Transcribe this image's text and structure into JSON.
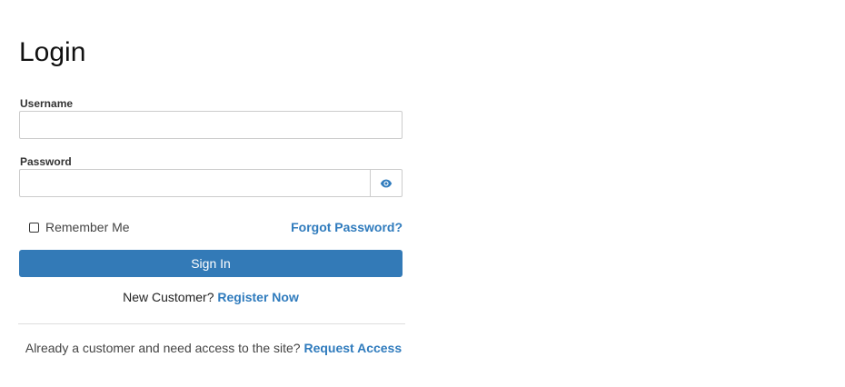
{
  "page": {
    "title": "Login"
  },
  "form": {
    "username_label": "Username",
    "username_value": "",
    "password_label": "Password",
    "password_value": "",
    "reveal_icon": "eye-icon",
    "remember_label": "Remember Me",
    "remember_checked": false,
    "forgot_link": "Forgot Password?",
    "signin_label": "Sign In"
  },
  "register": {
    "prompt": "New Customer?",
    "link": "Register Now"
  },
  "access": {
    "prompt": "Already a customer and need access to the site?",
    "link": "Request Access"
  },
  "colors": {
    "accent": "#337ab7",
    "link": "#2f7bbd",
    "border": "#cccccc"
  }
}
